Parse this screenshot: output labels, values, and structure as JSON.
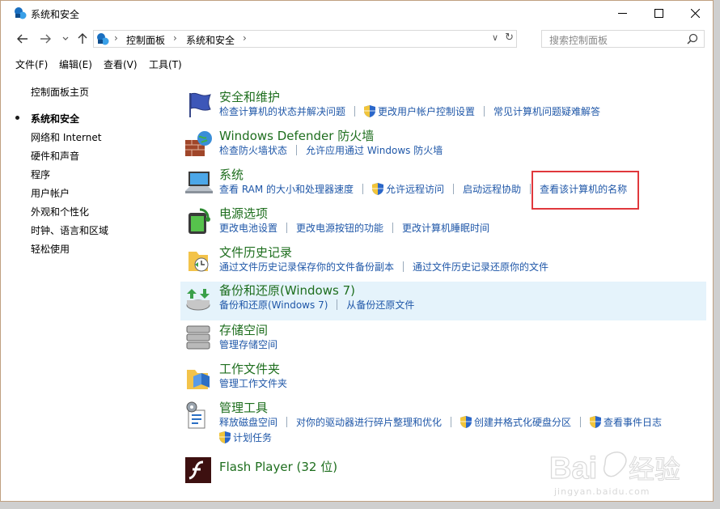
{
  "window": {
    "title": "系统和安全"
  },
  "address": {
    "crumbs": [
      "控制面板",
      "系统和安全"
    ],
    "search_placeholder": "搜索控制面板"
  },
  "menu": [
    "文件(F)",
    "编辑(E)",
    "查看(V)",
    "工具(T)"
  ],
  "sidebar": {
    "home": "控制面板主页",
    "items": [
      "系统和安全",
      "网络和 Internet",
      "硬件和声音",
      "程序",
      "用户帐户",
      "外观和个性化",
      "时钟、语言和区域",
      "轻松使用"
    ],
    "current_index": 0
  },
  "categories": [
    {
      "title": "安全和维护",
      "icon": "flag-icon",
      "links": [
        {
          "text": "检查计算机的状态并解决问题",
          "shield": false
        },
        {
          "text": "更改用户帐户控制设置",
          "shield": true
        },
        {
          "text": "常见计算机问题疑难解答",
          "shield": false
        }
      ]
    },
    {
      "title": "Windows Defender 防火墙",
      "icon": "firewall-icon",
      "links": [
        {
          "text": "检查防火墙状态",
          "shield": false
        },
        {
          "text": "允许应用通过 Windows 防火墙",
          "shield": false
        }
      ]
    },
    {
      "title": "系统",
      "icon": "computer-icon",
      "links": [
        {
          "text": "查看 RAM 的大小和处理器速度",
          "shield": false
        },
        {
          "text": "允许远程访问",
          "shield": true
        },
        {
          "text": "启动远程协助",
          "shield": false
        },
        {
          "text": "查看该计算机的名称",
          "shield": false
        }
      ]
    },
    {
      "title": "电源选项",
      "icon": "battery-icon",
      "links": [
        {
          "text": "更改电池设置",
          "shield": false
        },
        {
          "text": "更改电源按钮的功能",
          "shield": false
        },
        {
          "text": "更改计算机睡眠时间",
          "shield": false
        }
      ]
    },
    {
      "title": "文件历史记录",
      "icon": "file-history-icon",
      "links": [
        {
          "text": "通过文件历史记录保存你的文件备份副本",
          "shield": false
        },
        {
          "text": "通过文件历史记录还原你的文件",
          "shield": false
        }
      ]
    },
    {
      "title": "备份和还原(Windows 7)",
      "icon": "backup-icon",
      "links": [
        {
          "text": "备份和还原(Windows 7)",
          "shield": false
        },
        {
          "text": "从备份还原文件",
          "shield": false
        }
      ]
    },
    {
      "title": "存储空间",
      "icon": "storage-icon",
      "links": [
        {
          "text": "管理存储空间",
          "shield": false
        }
      ]
    },
    {
      "title": "工作文件夹",
      "icon": "work-folder-icon",
      "links": [
        {
          "text": "管理工作文件夹",
          "shield": false
        }
      ]
    },
    {
      "title": "管理工具",
      "icon": "admin-tools-icon",
      "links": [
        {
          "text": "释放磁盘空间",
          "shield": false
        },
        {
          "text": "对你的驱动器进行碎片整理和优化",
          "shield": false
        },
        {
          "text": "创建并格式化硬盘分区",
          "shield": true
        },
        {
          "text": "查看事件日志",
          "shield": true
        }
      ],
      "links2": [
        {
          "text": "计划任务",
          "shield": true
        }
      ]
    },
    {
      "title": "Flash Player (32 位)",
      "icon": "flash-icon",
      "links": []
    }
  ],
  "watermark": {
    "text": "Baidu经验",
    "sub": "jingyan.baidu.com"
  }
}
